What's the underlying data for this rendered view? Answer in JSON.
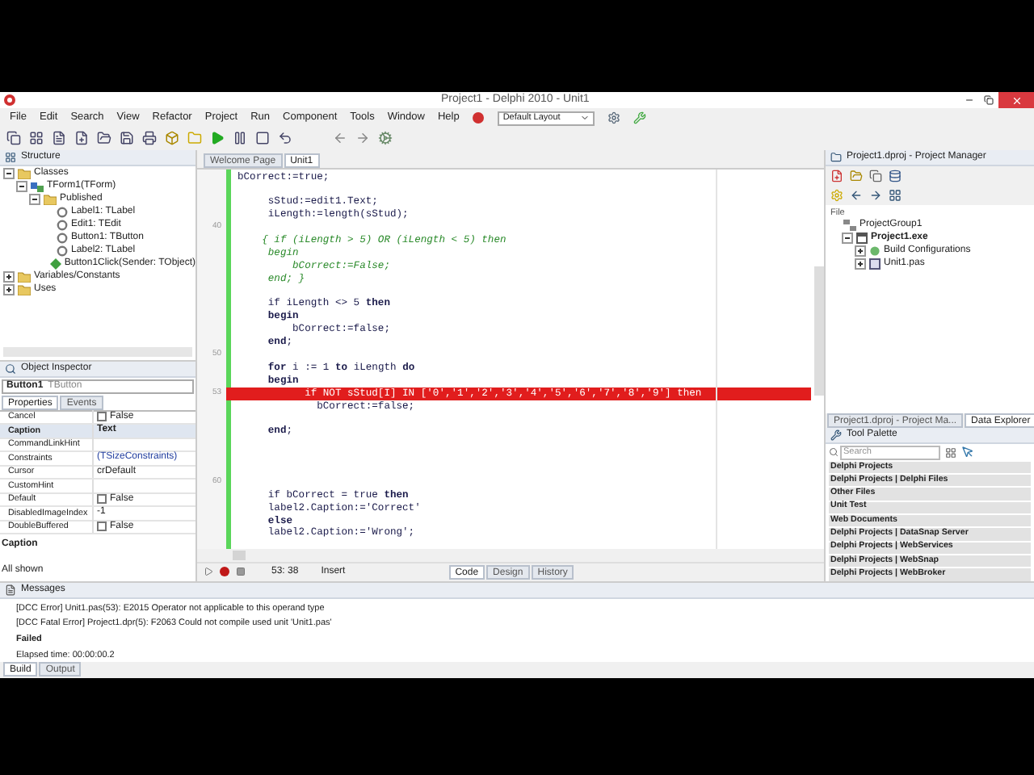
{
  "window": {
    "title": "Project1 - Delphi 2010 - Unit1"
  },
  "menu": [
    "File",
    "Edit",
    "Search",
    "View",
    "Refactor",
    "Project",
    "Run",
    "Component",
    "Tools",
    "Window",
    "Help"
  ],
  "layout_combo": {
    "value": "Default Layout"
  },
  "structure": {
    "title": "Structure",
    "tree": [
      {
        "label": "Classes",
        "kind": "folder",
        "expanded": true,
        "children": [
          {
            "label": "TForm1(TForm)",
            "kind": "form",
            "expanded": true,
            "children": [
              {
                "label": "Published",
                "kind": "folder",
                "expanded": true,
                "children": [
                  {
                    "label": "Label1: TLabel",
                    "kind": "property"
                  },
                  {
                    "label": "Edit1: TEdit",
                    "kind": "property"
                  },
                  {
                    "label": "Button1: TButton",
                    "kind": "property"
                  },
                  {
                    "label": "Label2: TLabel",
                    "kind": "property"
                  },
                  {
                    "label": "Button1Click(Sender: TObject)",
                    "kind": "method"
                  }
                ]
              }
            ]
          }
        ]
      },
      {
        "label": "Variables/Constants",
        "kind": "folder",
        "expanded": false
      },
      {
        "label": "Uses",
        "kind": "folder",
        "expanded": false
      }
    ]
  },
  "object_inspector": {
    "title": "Object Inspector",
    "selector": {
      "name": "Button1",
      "type": "TButton"
    },
    "tabs": [
      {
        "label": "Properties",
        "selected": true
      },
      {
        "label": "Events",
        "selected": false
      }
    ],
    "properties": [
      {
        "name": "Cancel",
        "kind": "bool",
        "checked": false,
        "value": "False",
        "selected": false
      },
      {
        "name": "Caption",
        "kind": "text",
        "value": "Text",
        "selected": true
      },
      {
        "name": "CommandLinkHint",
        "kind": "text",
        "selected": false
      },
      {
        "name": "Constraints",
        "kind": "set",
        "value": "(TSizeConstraints)",
        "selected": false
      },
      {
        "name": "Cursor",
        "kind": "text",
        "value": "crDefault",
        "selected": false
      },
      {
        "name": "CustomHint",
        "kind": "text",
        "selected": false
      },
      {
        "name": "Default",
        "kind": "bool",
        "checked": false,
        "value": "False",
        "selected": false
      },
      {
        "name": "DisabledImageIndex",
        "kind": "text",
        "value": "-1",
        "selected": false
      },
      {
        "name": "DoubleBuffered",
        "kind": "bool",
        "checked": false,
        "value": "False",
        "selected": false
      }
    ],
    "description": "Caption",
    "footer": "All shown"
  },
  "editor": {
    "tabs": [
      {
        "label": "Welcome Page",
        "selected": false
      },
      {
        "label": "Unit1",
        "selected": true
      }
    ],
    "lines": [
      {
        "kind": "code",
        "text": "bCorrect:=true;"
      },
      {
        "kind": "blank"
      },
      {
        "kind": "code",
        "text": "     sStud:=edit1.Text;"
      },
      {
        "kind": "code",
        "text": "     iLength:=length(sStud);"
      },
      {
        "kind": "blank",
        "gutter": "40"
      },
      {
        "kind": "comment",
        "text": "    { if (iLength > 5) OR (iLength < 5) then"
      },
      {
        "kind": "comment",
        "text": "     begin"
      },
      {
        "kind": "comment",
        "text": "         bCorrect:=False;"
      },
      {
        "kind": "comment",
        "text": "     end; }"
      },
      {
        "kind": "blank"
      },
      {
        "kind": "code",
        "text": "     if iLength <> 5 **then**"
      },
      {
        "kind": "code",
        "text": "     **begin**"
      },
      {
        "kind": "code",
        "text": "         bCorrect:=false;"
      },
      {
        "kind": "code",
        "text": "     **end**;"
      },
      {
        "kind": "blank",
        "gutter": "50"
      },
      {
        "kind": "code",
        "text": "     **for** i := 1 **to** iLength **do**"
      },
      {
        "kind": "code",
        "text": "     **begin**"
      },
      {
        "kind": "error",
        "text": "           if NOT sStud[I] IN ['0','1','2','3','4','5','6','7','8','9'] then",
        "gutter": "53"
      },
      {
        "kind": "code",
        "text": "             bCorrect:=false;"
      },
      {
        "kind": "blank"
      },
      {
        "kind": "code",
        "text": "     **end**;"
      },
      {
        "kind": "blank"
      },
      {
        "kind": "blank"
      },
      {
        "kind": "blank"
      },
      {
        "kind": "blank",
        "gutter": "60"
      },
      {
        "kind": "code",
        "text": "     if bCorrect = true **then**"
      },
      {
        "kind": "code",
        "text": "     label2.Caption:='Correct'"
      },
      {
        "kind": "code",
        "text": "     **else**"
      },
      {
        "kind": "code",
        "text": "     label2.Caption:='Wrong';"
      }
    ],
    "position": "53: 38",
    "mode": "Insert",
    "view_tabs": [
      {
        "label": "Code",
        "selected": true
      },
      {
        "label": "Design",
        "selected": false
      },
      {
        "label": "History",
        "selected": false
      }
    ]
  },
  "project_manager": {
    "title": "Project1.dproj - Project Manager",
    "column": "File",
    "tree": [
      {
        "label": "ProjectGroup1",
        "kind": "group",
        "children": [
          {
            "label": "Project1.exe",
            "kind": "exe",
            "bold": true,
            "expanded": true,
            "children": [
              {
                "label": "Build Configurations",
                "kind": "config",
                "expanded": false
              },
              {
                "label": "Unit1.pas",
                "kind": "file",
                "expanded": false
              }
            ]
          }
        ]
      }
    ],
    "tabs": [
      {
        "label": "Project1.dproj - Project Ma...",
        "selected": false
      },
      {
        "label": "Data Explorer",
        "selected": true
      }
    ]
  },
  "tool_palette": {
    "title": "Tool Palette",
    "search": {
      "placeholder": "Search"
    },
    "categories": [
      "Delphi Projects",
      "Delphi Projects | Delphi Files",
      "Other Files",
      "Unit Test",
      "Web Documents",
      "Delphi Projects | DataSnap Server",
      "Delphi Projects | WebServices",
      "Delphi Projects | WebSnap",
      "Delphi Projects | WebBroker"
    ]
  },
  "messages": {
    "title": "Messages",
    "lines": [
      {
        "text": "[DCC Error] Unit1.pas(53): E2015 Operator not applicable to this operand type",
        "bold": false
      },
      {
        "text": "[DCC Fatal Error] Project1.dpr(5): F2063 Could not compile used unit 'Unit1.pas'",
        "bold": false
      },
      {
        "text": "Failed",
        "bold": true
      },
      {
        "text": "Elapsed time: 00:00:00.2",
        "bold": false
      }
    ],
    "tabs": [
      {
        "label": "Build",
        "selected": true
      },
      {
        "label": "Output",
        "selected": false
      }
    ]
  }
}
